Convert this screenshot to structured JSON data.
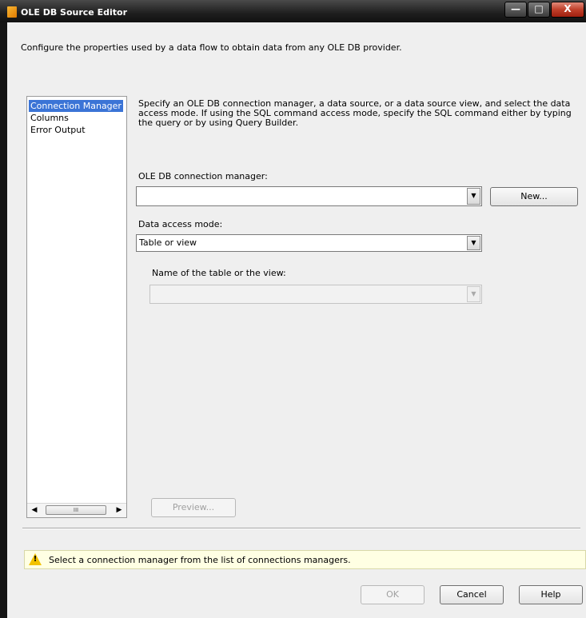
{
  "window": {
    "title": "OLE DB Source Editor",
    "min_glyph": "—",
    "max_glyph": "□",
    "close_glyph": "X"
  },
  "description": "Configure the properties used by a data flow to obtain data from any OLE DB provider.",
  "nav": {
    "items": [
      {
        "label": "Connection Manager",
        "selected": true
      },
      {
        "label": "Columns",
        "selected": false
      },
      {
        "label": "Error Output",
        "selected": false
      }
    ],
    "scroll_left": "◀",
    "scroll_right": "▶",
    "scroll_thumb": "III"
  },
  "main": {
    "help_text": "Specify an OLE DB connection manager, a data source, or a data source view, and select the data access mode. If using the SQL command access mode, specify the SQL command either by typing the query or by using Query Builder.",
    "connection_label": "OLE DB connection manager:",
    "connection_value": "",
    "new_button": "New...",
    "access_mode_label": "Data access mode:",
    "access_mode_value": "Table or view",
    "table_label": "Name of the table or the view:",
    "table_value": "",
    "dropdown_glyph": "▼",
    "preview_button": "Preview..."
  },
  "warning": {
    "icon": "warning-icon",
    "bang": "!",
    "text": "Select a connection manager from the list of connections managers."
  },
  "footer": {
    "ok": "OK",
    "cancel": "Cancel",
    "help": "Help"
  }
}
